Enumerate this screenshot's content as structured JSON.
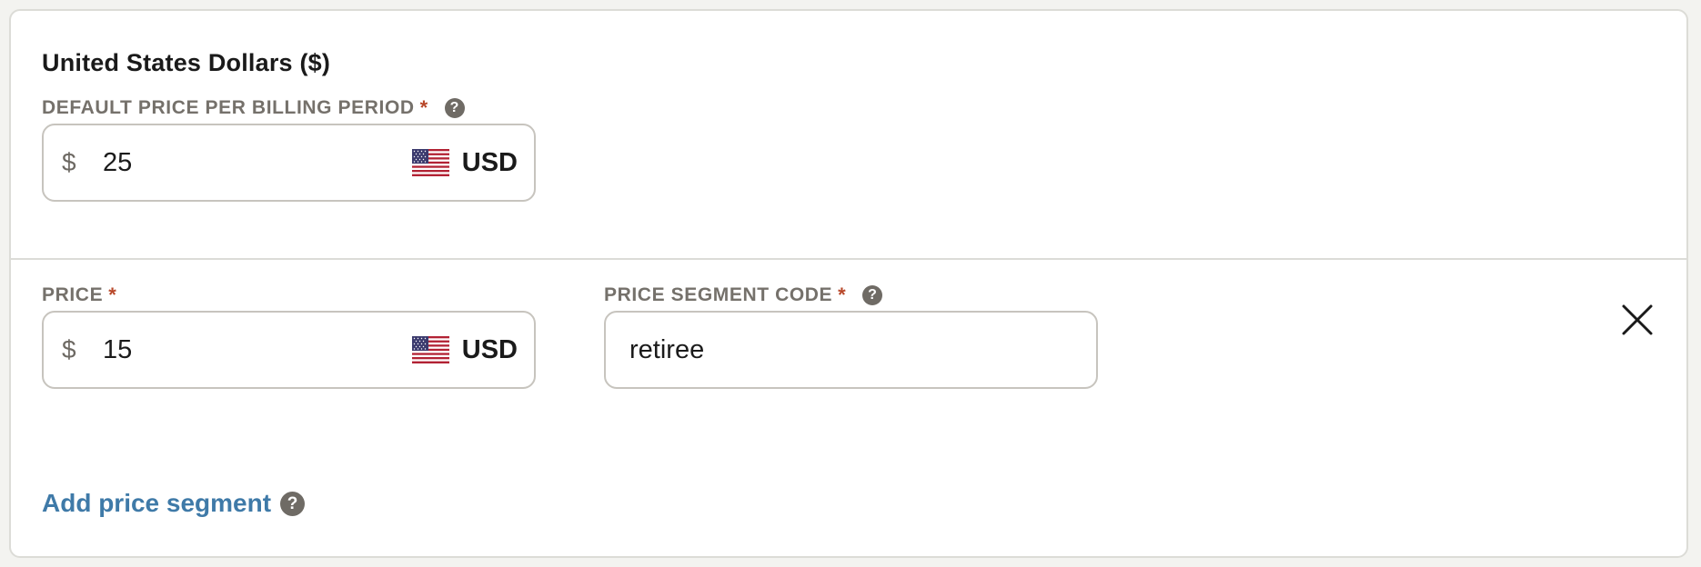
{
  "currency_section": {
    "title": "United States Dollars ($)",
    "default_price": {
      "label": "DEFAULT PRICE PER BILLING PERIOD",
      "required_mark": "*",
      "help_glyph": "?",
      "symbol": "$",
      "value": "25",
      "currency_code": "USD",
      "flag_icon": "us-flag-icon"
    }
  },
  "segment": {
    "price": {
      "label": "PRICE",
      "required_mark": "*",
      "symbol": "$",
      "value": "15",
      "currency_code": "USD",
      "flag_icon": "us-flag-icon"
    },
    "segment_code": {
      "label": "PRICE SEGMENT CODE",
      "required_mark": "*",
      "help_glyph": "?",
      "value": "retiree"
    },
    "remove_icon": "close-icon"
  },
  "add_segment": {
    "label": "Add price segment",
    "help_glyph": "?"
  },
  "colors": {
    "accent_link": "#3f7aa8",
    "required": "#b8482a",
    "label": "#75716b",
    "border": "#c7c4be"
  }
}
